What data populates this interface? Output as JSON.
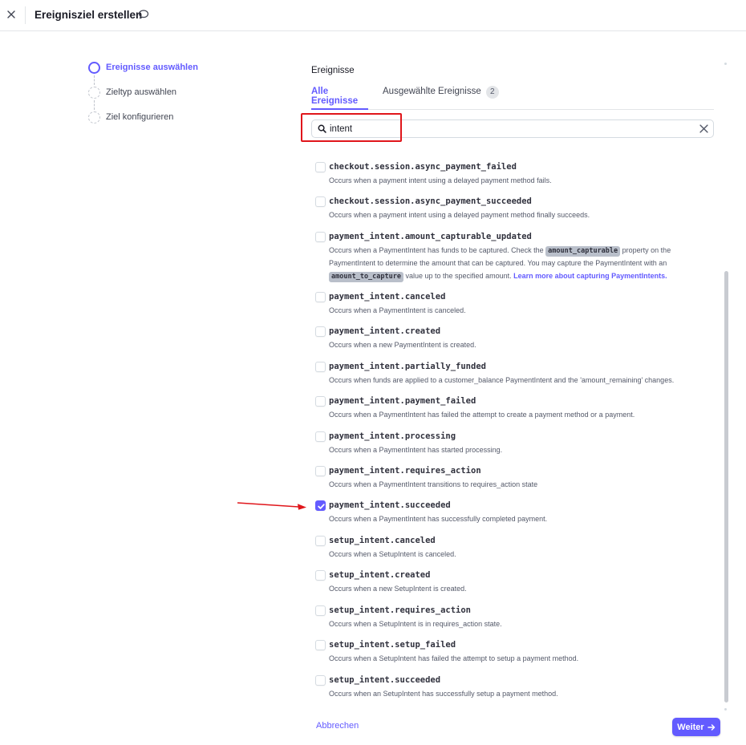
{
  "header": {
    "title": "Ereignisziel erstellen"
  },
  "steps": [
    {
      "label": "Ereignisse auswählen",
      "state": "active"
    },
    {
      "label": "Zieltyp auswählen",
      "state": "pending"
    },
    {
      "label": "Ziel konfigurieren",
      "state": "pending"
    }
  ],
  "main": {
    "section_label": "Ereignisse",
    "tabs": {
      "all": "Alle Ereignisse",
      "selected": "Ausgewählte Ereignisse",
      "selected_count": "2"
    },
    "search": {
      "value": "intent"
    }
  },
  "events": [
    {
      "name": "checkout.session.async_payment_failed",
      "desc": "Occurs when a payment intent using a delayed payment method fails.",
      "checked": false
    },
    {
      "name": "checkout.session.async_payment_succeeded",
      "desc": "Occurs when a payment intent using a delayed payment method finally succeeds.",
      "checked": false
    },
    {
      "name": "payment_intent.amount_capturable_updated",
      "desc_parts": {
        "p1": "Occurs when a PaymentIntent has funds to be captured. Check the ",
        "code1": "amount_capturable",
        "p2": " property on the PaymentIntent to determine the amount that can be captured. You may capture the PaymentIntent with an ",
        "code2": "amount_to_capture",
        "p3": " value up to the specified amount. ",
        "link": "Learn more about capturing PaymentIntents."
      },
      "checked": false
    },
    {
      "name": "payment_intent.canceled",
      "desc": "Occurs when a PaymentIntent is canceled.",
      "checked": false
    },
    {
      "name": "payment_intent.created",
      "desc": "Occurs when a new PaymentIntent is created.",
      "checked": false
    },
    {
      "name": "payment_intent.partially_funded",
      "desc": "Occurs when funds are applied to a customer_balance PaymentIntent and the 'amount_remaining' changes.",
      "checked": false
    },
    {
      "name": "payment_intent.payment_failed",
      "desc": "Occurs when a PaymentIntent has failed the attempt to create a payment method or a payment.",
      "checked": false
    },
    {
      "name": "payment_intent.processing",
      "desc": "Occurs when a PaymentIntent has started processing.",
      "checked": false
    },
    {
      "name": "payment_intent.requires_action",
      "desc": "Occurs when a PaymentIntent transitions to requires_action state",
      "checked": false
    },
    {
      "name": "payment_intent.succeeded",
      "desc": "Occurs when a PaymentIntent has successfully completed payment.",
      "checked": true
    },
    {
      "name": "setup_intent.canceled",
      "desc": "Occurs when a SetupIntent is canceled.",
      "checked": false
    },
    {
      "name": "setup_intent.created",
      "desc": "Occurs when a new SetupIntent is created.",
      "checked": false
    },
    {
      "name": "setup_intent.requires_action",
      "desc": "Occurs when a SetupIntent is in requires_action state.",
      "checked": false
    },
    {
      "name": "setup_intent.setup_failed",
      "desc": "Occurs when a SetupIntent has failed the attempt to setup a payment method.",
      "checked": false
    },
    {
      "name": "setup_intent.succeeded",
      "desc": "Occurs when an SetupIntent has successfully setup a payment method.",
      "checked": false
    }
  ],
  "footer": {
    "cancel_label": "Abbrechen",
    "next_label": "Weiter"
  },
  "colors": {
    "accent": "#635bff",
    "annotation_red": "#e0161b"
  },
  "icons": {
    "close": "close-icon",
    "feedback": "speech-bubble-icon",
    "search": "search-icon",
    "clear": "clear-icon",
    "next": "arrow-right-icon",
    "check": "check-icon"
  }
}
